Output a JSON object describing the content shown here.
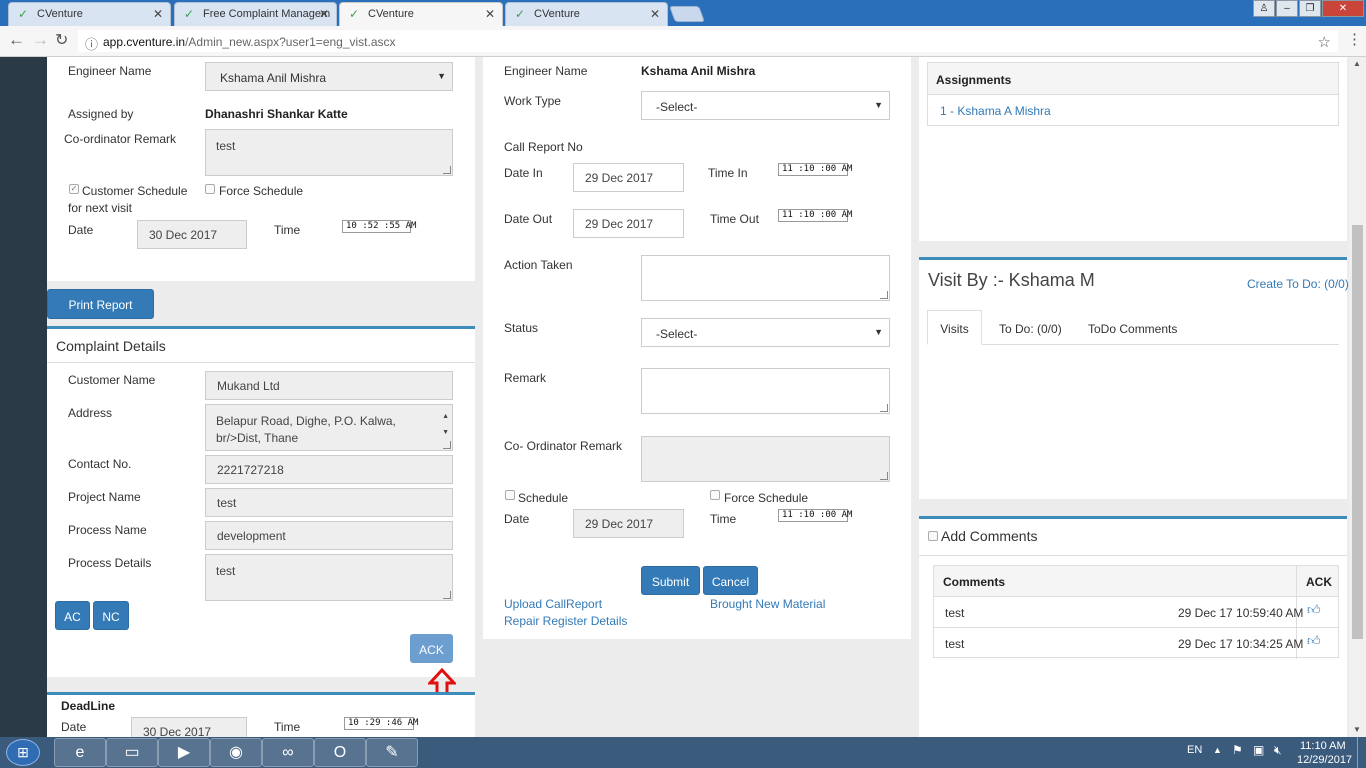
{
  "browser": {
    "tabs": [
      {
        "title": "CVenture"
      },
      {
        "title": "Free Complaint Managem"
      },
      {
        "title": "CVenture"
      },
      {
        "title": "CVenture"
      }
    ],
    "url_host": "app.cventure.in",
    "url_path": "/Admin_new.aspx?user1=eng_vist.ascx"
  },
  "left_top": {
    "engineer_name_label": "Engineer Name",
    "engineer_name_value": "Kshama Anil Mishra",
    "assigned_by_label": "Assigned by",
    "assigned_by_value": "Dhanashri Shankar Katte",
    "coordinator_remark_label": "Co-ordinator Remark",
    "coordinator_remark_value": "test",
    "customer_schedule_label": "Customer Schedule",
    "customer_schedule_label2": "for next visit",
    "force_schedule_label": "Force Schedule",
    "date_label": "Date",
    "date_value": "30 Dec 2017",
    "time_label": "Time",
    "time_value": "10 :52 :55  AM"
  },
  "print_report": "Print Report",
  "complaint": {
    "title": "Complaint Details",
    "customer_name_label": "Customer Name",
    "customer_name_value": "Mukand Ltd",
    "address_label": "Address",
    "address_line1": "Belapur Road, Dighe, P.O. Kalwa,",
    "address_line2": "br/>Dist, Thane",
    "contact_label": "Contact No.",
    "contact_value": "2221727218",
    "project_label": "Project Name",
    "project_value": "test",
    "process_name_label": "Process Name",
    "process_name_value": "development",
    "process_details_label": "Process Details",
    "process_details_value": "test",
    "ac": "AC",
    "nc": "NC",
    "ack": "ACK"
  },
  "deadline": {
    "title": "DeadLine",
    "date_label": "Date",
    "date_value": "30 Dec 2017",
    "time_label": "Time",
    "time_value": "10 :29 :46  AM"
  },
  "middle": {
    "engineer_name_label": "Engineer Name",
    "engineer_name_value": "Kshama Anil Mishra",
    "work_type_label": "Work Type",
    "work_type_value": "-Select-",
    "call_report_label": "Call Report No",
    "date_in_label": "Date In",
    "date_in_value": "29 Dec 2017",
    "time_in_label": "Time In",
    "time_in_value": "11 :10 :00  AM",
    "date_out_label": "Date Out",
    "date_out_value": "29 Dec 2017",
    "time_out_label": "Time Out",
    "time_out_value": "11 :10 :00  AM",
    "action_taken_label": "Action Taken",
    "status_label": "Status",
    "status_value": "-Select-",
    "remark_label": "Remark",
    "coordinator_remark_label": "Co- Ordinator Remark",
    "schedule_label": "Schedule",
    "force_schedule_label": "Force Schedule",
    "date_label": "Date",
    "date_value": "29 Dec 2017",
    "time_label": "Time",
    "time_value": "11 :10 :00  AM",
    "submit": "Submit",
    "cancel": "Cancel",
    "upload_link": "Upload CallReport",
    "brought_link": "Brought New Material",
    "repair_link": "Repair Register Details"
  },
  "right": {
    "assignments_title": "Assignments",
    "assignment_item": "1 - Kshama A Mishra",
    "visit_title": "Visit By :- Kshama M",
    "create_todo": "Create To Do: (0/0)",
    "tabs": [
      "Visits",
      "To Do: (0/0)",
      "ToDo Comments"
    ],
    "add_comments": "Add Comments",
    "comments_header": "Comments",
    "ack_header": "ACK",
    "comments": [
      {
        "text": "test",
        "time": "29 Dec 17 10:59:40 AM"
      },
      {
        "text": "test",
        "time": "29 Dec 17 10:34:25 AM"
      }
    ]
  },
  "taskbar": {
    "lang": "EN",
    "time": "11:10 AM",
    "date": "12/29/2017"
  }
}
